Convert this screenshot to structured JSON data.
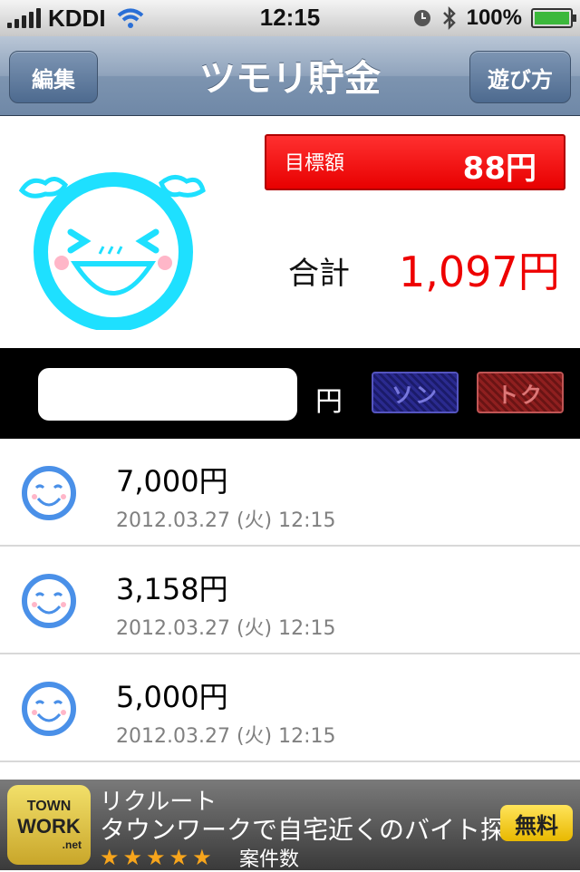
{
  "status_bar": {
    "carrier": "KDDI",
    "time": "12:15",
    "battery": "100%"
  },
  "nav": {
    "left_button": "編集",
    "title": "ツモリ貯金",
    "right_button": "遊び方"
  },
  "summary": {
    "goal_label": "目標額",
    "goal_value": "88円",
    "total_label": "合計",
    "total_value": "1,097円"
  },
  "input_bar": {
    "amount_value": "",
    "yen": "円",
    "loss_button": "ソン",
    "gain_button": "トク"
  },
  "entries": [
    {
      "amount": "7,000円",
      "date": "2012.03.27 (火) 12:15"
    },
    {
      "amount": "3,158円",
      "date": "2012.03.27 (火) 12:15"
    },
    {
      "amount": "5,000円",
      "date": "2012.03.27 (火) 12:15"
    }
  ],
  "ad": {
    "logo_top": "TOWN",
    "logo_mid": "WORK",
    "logo_net": ".net",
    "brand": "リクルート",
    "text": "タウンワークで自宅近くのバイト探し",
    "badge": "無料",
    "stars": "★★★★★",
    "sub": "案件数"
  },
  "colors": {
    "accent_red": "#ee0000",
    "mascot_cyan": "#1ee0ff",
    "row_icon_blue": "#4a90e8"
  }
}
